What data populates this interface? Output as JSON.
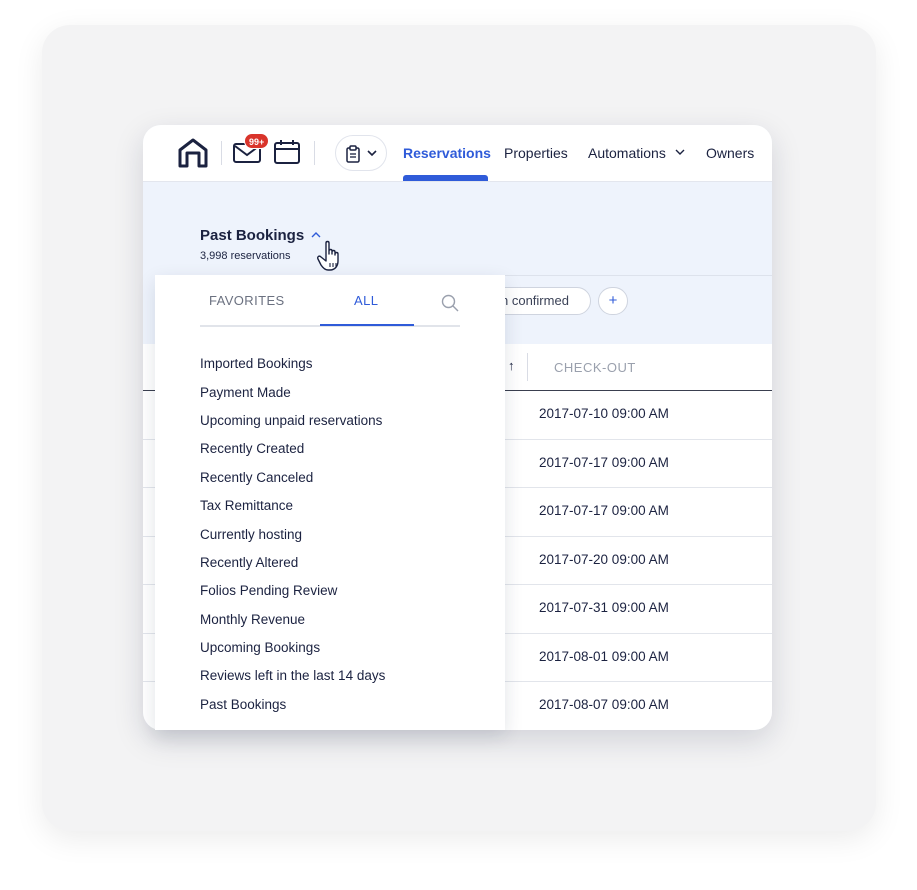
{
  "nav": {
    "mail_badge": "99+",
    "tabs": [
      {
        "label": "Reservations",
        "active": true
      },
      {
        "label": "Properties"
      },
      {
        "label": "Automations",
        "has_dropdown": true
      },
      {
        "label": "Owners"
      }
    ]
  },
  "view": {
    "title": "Past Bookings",
    "count": "3,998 reservations"
  },
  "filters": {
    "chip_partial": "n confirmed",
    "add_label": "+"
  },
  "table": {
    "sort_indicator": "↑",
    "checkout_header": "CHECK-OUT",
    "rows": [
      "2017-07-10 09:00 AM",
      "2017-07-17 09:00 AM",
      "2017-07-17 09:00 AM",
      "2017-07-20 09:00 AM",
      "2017-07-31 09:00 AM",
      "2017-08-01 09:00 AM",
      "2017-08-07 09:00 AM"
    ]
  },
  "dropdown": {
    "tabs": {
      "favorites": "FAVORITES",
      "all": "ALL"
    },
    "active_tab": "all",
    "items": [
      "Imported Bookings",
      "Payment Made",
      "Upcoming unpaid reservations",
      "Recently Created",
      "Recently Canceled",
      "Tax Remittance",
      "Currently hosting",
      "Recently Altered",
      "Folios Pending Review",
      "Monthly Revenue",
      "Upcoming Bookings",
      "Reviews left in the last 14 days",
      "Past Bookings"
    ]
  },
  "colors": {
    "accent": "#2f5bd9",
    "navy": "#1b2240",
    "badge": "#d9342b",
    "content_bg": "#eef3fc"
  }
}
